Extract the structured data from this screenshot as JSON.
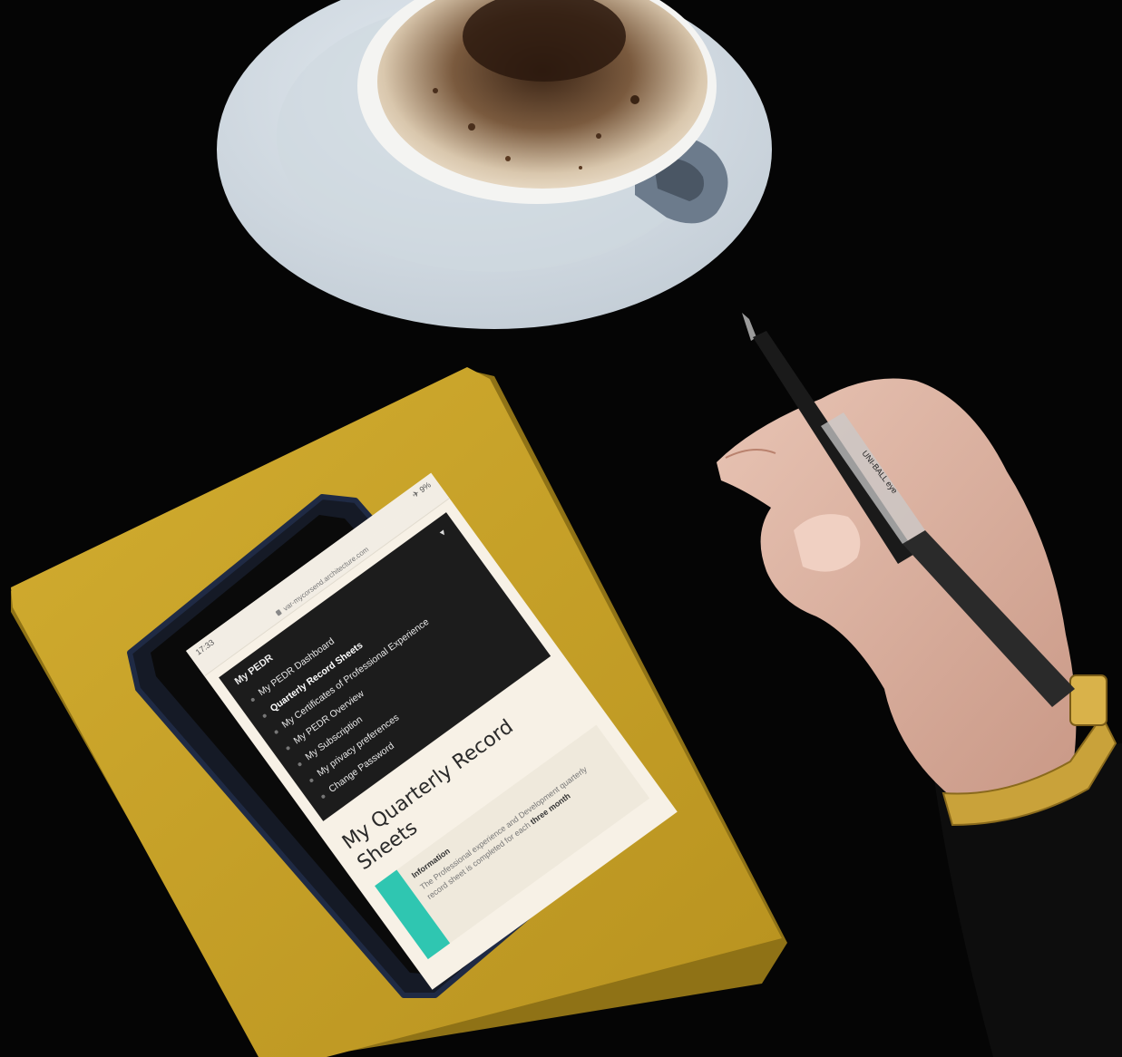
{
  "screen": {
    "status_time": "17:33",
    "status_right": "✈ 9%",
    "url": "var-mycorsend.architecture.com",
    "menu": {
      "heading": "My PEDR",
      "items": [
        {
          "label": "My PEDR Dashboard",
          "active": false
        },
        {
          "label": "Quarterly Record Sheets",
          "active": true
        },
        {
          "label": "My Certificates of Professional Experience",
          "active": false
        },
        {
          "label": "My PEDR Overview",
          "active": false
        },
        {
          "label": "My Subscription",
          "active": false
        },
        {
          "label": "My privacy preferences",
          "active": false
        },
        {
          "label": "Change Password",
          "active": false
        }
      ]
    },
    "page_title": "My Quarterly Record Sheets",
    "info": {
      "title": "Information",
      "body": "The Professional experience and Development quarterly record sheet is completed for each",
      "emphasis": "three month"
    }
  },
  "pen_label": "UNI-BALL eye",
  "colors": {
    "background": "#050505",
    "notebook": "#c9a42a",
    "accent_teal": "#2fc6b1",
    "menu_dark": "#1c1c1c"
  }
}
